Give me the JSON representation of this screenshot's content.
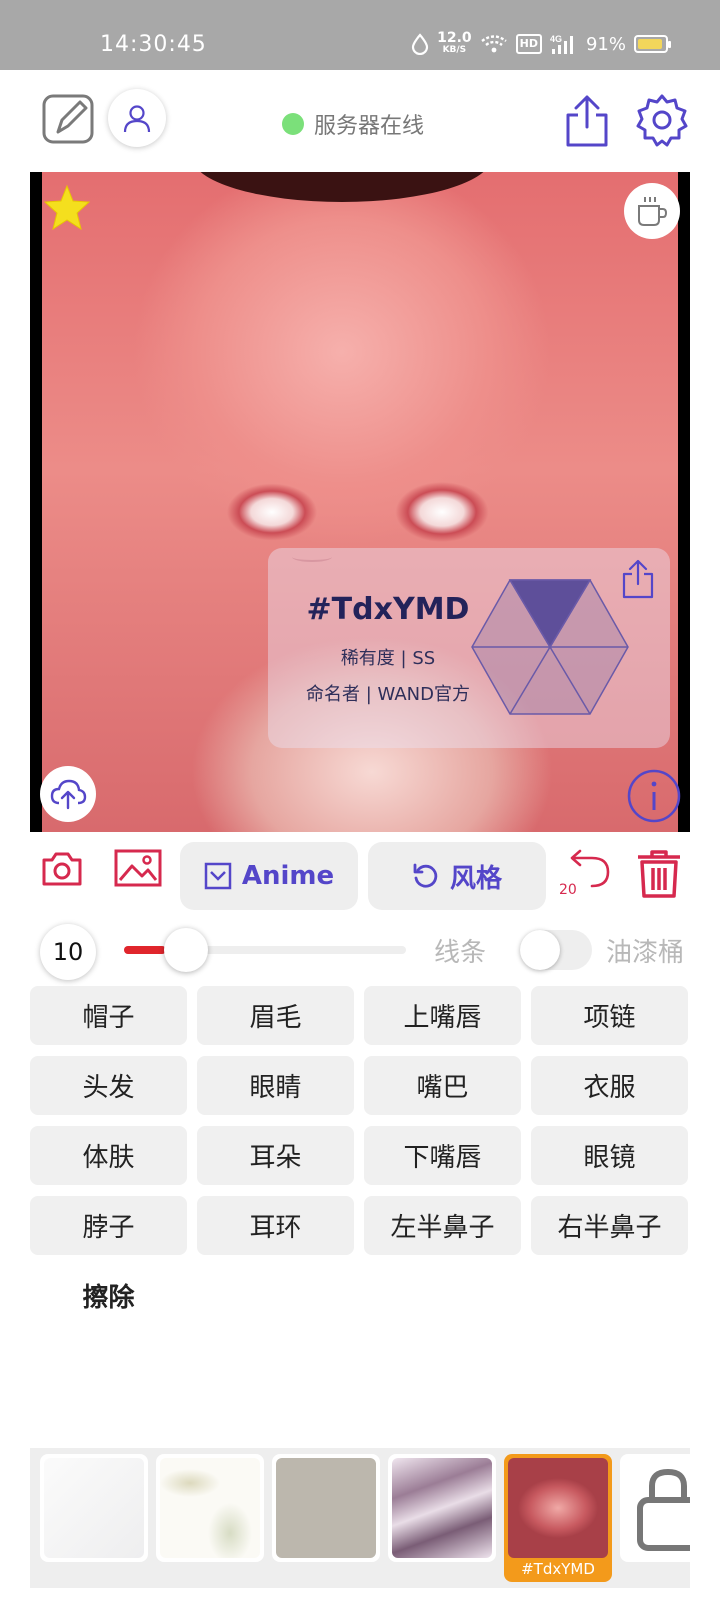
{
  "status_bar": {
    "time": "14:30:45",
    "net_speed_value": "12.0",
    "net_speed_unit": "KB/S",
    "hd_label": "HD",
    "signal_label": "4G",
    "battery_percent": "91%",
    "battery_level": 0.91
  },
  "header": {
    "server_status": "服务器在线",
    "server_status_color": "#7be07a"
  },
  "card": {
    "title": "#TdxYMD",
    "rarity": "稀有度 | SS",
    "namer": "命名者 | WAND官方"
  },
  "toolbar": {
    "model_label": "Anime",
    "style_label": "风格",
    "undo_count": "20",
    "accent": "#5446c9",
    "danger": "#d6294e"
  },
  "brush": {
    "size": "10",
    "slider_level": 0.15,
    "line_label": "线条",
    "bucket_label": "油漆桶",
    "bucket_enabled": false
  },
  "segments": [
    "帽子",
    "眉毛",
    "上嘴唇",
    "项链",
    "头发",
    "眼睛",
    "嘴巴",
    "衣服",
    "体肤",
    "耳朵",
    "下嘴唇",
    "眼镜",
    "脖子",
    "耳环",
    "左半鼻子",
    "右半鼻子"
  ],
  "erase_label": "擦除",
  "thumbnails": {
    "selected_label": "#TdxYMD"
  }
}
